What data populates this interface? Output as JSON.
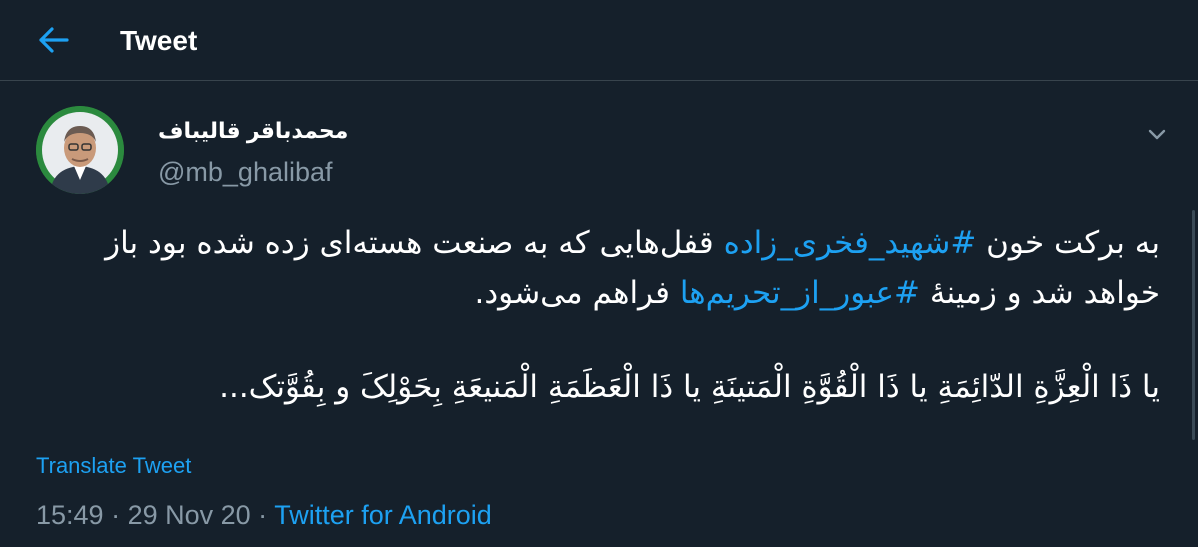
{
  "header": {
    "back_icon": "arrow-left-icon",
    "title": "Tweet"
  },
  "author": {
    "display_name": "محمدباقر قالیباف",
    "handle": "@mb_ghalibaf",
    "menu_icon": "chevron-down-icon"
  },
  "tweet": {
    "line1_prefix": "به برکت خون ",
    "hashtag1": "#شهید_فخری_زاده",
    "line1_suffix": " قفل‌هایی که به صنعت هسته‌ای زده شده بود باز خواهد شد و زمینهٔ ",
    "hashtag2": "#عبور_از_تحریم‌ها",
    "line1_end": " فراهم می‌شود.",
    "line2": "یا ذَا الْعِزَّةِ الدّائِمَةِ یا ذَا الْقُوَّةِ الْمَتینَةِ یا ذَا الْعَظَمَةِ الْمَنیعَةِ بِحَوْلِکَ و بِقُوَّتک..."
  },
  "translate_label": "Translate Tweet",
  "meta": {
    "time": "15:49",
    "separator": " · ",
    "date": "29 Nov 20",
    "source": "Twitter for Android"
  },
  "colors": {
    "background": "#15202b",
    "accent": "#1da1f2",
    "secondary_text": "#8899a6",
    "divider": "#38444d"
  }
}
